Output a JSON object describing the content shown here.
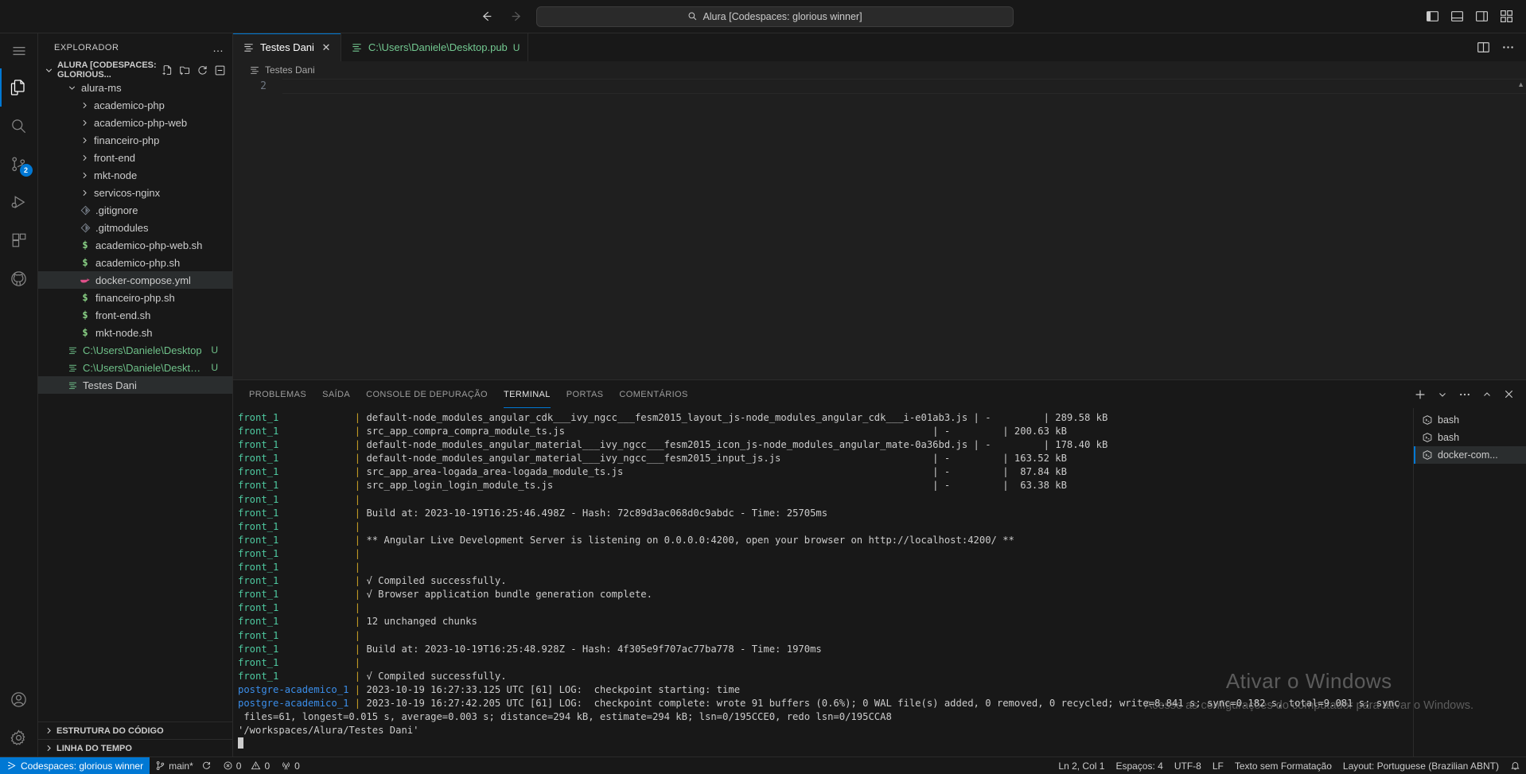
{
  "titlebar": {
    "back_icon": "arrow-left-icon",
    "forward_icon": "arrow-right-icon",
    "search_text": "Alura [Codespaces: glorious winner]",
    "search_placeholder": "Pesquisar",
    "layout_icons": [
      "toggle-primary-sidebar-icon",
      "toggle-panel-icon",
      "toggle-secondary-sidebar-icon",
      "customize-layout-icon"
    ]
  },
  "activitybar": {
    "items": [
      {
        "name": "menu-icon",
        "label": "Menu",
        "badge": ""
      },
      {
        "name": "explorer-icon",
        "label": "Explorador",
        "badge": ""
      },
      {
        "name": "search-icon",
        "label": "Pesquisar",
        "badge": ""
      },
      {
        "name": "source-control-icon",
        "label": "Controle do Código-Fonte",
        "badge": "2"
      },
      {
        "name": "run-debug-icon",
        "label": "Executar e Depurar",
        "badge": ""
      },
      {
        "name": "extensions-icon",
        "label": "Extensões",
        "badge": ""
      },
      {
        "name": "github-icon",
        "label": "GitHub",
        "badge": ""
      }
    ],
    "bottom": [
      {
        "name": "accounts-icon",
        "label": "Contas"
      },
      {
        "name": "settings-gear-icon",
        "label": "Gerenciar"
      }
    ]
  },
  "sidebar": {
    "title": "EXPLORADOR",
    "more_actions": "…",
    "project": {
      "label": "ALURA [CODESPACES: GLORIOUS...",
      "actions": [
        "new-file-icon",
        "new-folder-icon",
        "refresh-icon",
        "collapse-all-icon"
      ]
    },
    "tree": [
      {
        "label": "alura-ms",
        "type": "folder",
        "depth": 1,
        "expanded": true,
        "icon": "chevron-down-icon",
        "badge": ""
      },
      {
        "label": "academico-php",
        "type": "folder",
        "depth": 2,
        "expanded": false,
        "icon": "chevron-right-icon",
        "badge": ""
      },
      {
        "label": "academico-php-web",
        "type": "folder",
        "depth": 2,
        "expanded": false,
        "icon": "chevron-right-icon",
        "badge": ""
      },
      {
        "label": "financeiro-php",
        "type": "folder",
        "depth": 2,
        "expanded": false,
        "icon": "chevron-right-icon",
        "badge": ""
      },
      {
        "label": "front-end",
        "type": "folder",
        "depth": 2,
        "expanded": false,
        "icon": "chevron-right-icon",
        "badge": ""
      },
      {
        "label": "mkt-node",
        "type": "folder",
        "depth": 2,
        "expanded": false,
        "icon": "chevron-right-icon",
        "badge": ""
      },
      {
        "label": "servicos-nginx",
        "type": "folder",
        "depth": 2,
        "expanded": false,
        "icon": "chevron-right-icon",
        "badge": ""
      },
      {
        "label": ".gitignore",
        "type": "git",
        "depth": 2,
        "icon": "git-file-icon",
        "badge": ""
      },
      {
        "label": ".gitmodules",
        "type": "git",
        "depth": 2,
        "icon": "git-file-icon",
        "badge": ""
      },
      {
        "label": "academico-php-web.sh",
        "type": "shell",
        "depth": 2,
        "icon": "shell-file-icon",
        "badge": ""
      },
      {
        "label": "academico-php.sh",
        "type": "shell",
        "depth": 2,
        "icon": "shell-file-icon",
        "badge": ""
      },
      {
        "label": "docker-compose.yml",
        "type": "docker",
        "depth": 2,
        "icon": "docker-file-icon",
        "badge": "",
        "selected": true
      },
      {
        "label": "financeiro-php.sh",
        "type": "shell",
        "depth": 2,
        "icon": "shell-file-icon",
        "badge": ""
      },
      {
        "label": "front-end.sh",
        "type": "shell",
        "depth": 2,
        "icon": "shell-file-icon",
        "badge": ""
      },
      {
        "label": "mkt-node.sh",
        "type": "shell",
        "depth": 2,
        "icon": "shell-file-icon",
        "badge": ""
      },
      {
        "label": "C:\\Users\\Daniele\\Desktop",
        "type": "text",
        "depth": 1,
        "icon": "text-file-icon",
        "badge": "U",
        "green": true
      },
      {
        "label": "C:\\Users\\Daniele\\Desktop.pub",
        "type": "text",
        "depth": 1,
        "icon": "text-file-icon",
        "badge": "U",
        "green": true
      },
      {
        "label": "Testes Dani",
        "type": "text",
        "depth": 1,
        "icon": "text-file-icon",
        "badge": "",
        "selected": true
      }
    ],
    "sections": [
      {
        "label": "ESTRUTURA DO CÓDIGO",
        "icon": "chevron-right-icon"
      },
      {
        "label": "LINHA DO TEMPO",
        "icon": "chevron-right-icon"
      }
    ]
  },
  "editor": {
    "tabs": [
      {
        "label": "Testes Dani",
        "active": true,
        "icon": "text-file-icon",
        "close": "✕",
        "dirty": "",
        "green": false
      },
      {
        "label": "C:\\Users\\Daniele\\Desktop.pub",
        "active": false,
        "icon": "text-file-icon",
        "close": "",
        "dirty": "U",
        "green": true
      }
    ],
    "actions": [
      "split-editor-icon",
      "more-actions-icon"
    ],
    "breadcrumb": "Testes Dani",
    "breadcrumb_icon": "text-file-icon",
    "line_number": "2"
  },
  "panel": {
    "tabs": [
      {
        "label": "PROBLEMAS",
        "active": false
      },
      {
        "label": "SAÍDA",
        "active": false
      },
      {
        "label": "CONSOLE DE DEPURAÇÃO",
        "active": false
      },
      {
        "label": "TERMINAL",
        "active": true
      },
      {
        "label": "PORTAS",
        "active": false
      },
      {
        "label": "COMENTÁRIOS",
        "active": false
      }
    ],
    "actions": [
      "add-terminal-icon",
      "chevron-down-icon",
      "more-actions-icon",
      "chevron-up-icon",
      "close-icon"
    ],
    "terminal_list": [
      {
        "label": "bash",
        "icon": "terminal-bash-icon",
        "active": false
      },
      {
        "label": "bash",
        "icon": "terminal-bash-icon",
        "active": false
      },
      {
        "label": "docker-com...",
        "icon": "terminal-bash-icon",
        "active": true
      }
    ],
    "terminal_lines": [
      {
        "svc": "front_1",
        "svc_color": "green",
        "bar": "|",
        "text": "default-node_modules_angular_cdk___ivy_ngcc___fesm2015_layout_js-node_modules_angular_cdk___i-e01ab3.js | -         | 289.58 kB"
      },
      {
        "svc": "front_1",
        "svc_color": "green",
        "bar": "|",
        "text": "src_app_compra_compra_module_ts.js                                                               | -         | 200.63 kB"
      },
      {
        "svc": "front_1",
        "svc_color": "green",
        "bar": "|",
        "text": "default-node_modules_angular_material___ivy_ngcc___fesm2015_icon_js-node_modules_angular_mate-0a36bd.js | -         | 178.40 kB"
      },
      {
        "svc": "front_1",
        "svc_color": "green",
        "bar": "|",
        "text": "default-node_modules_angular_material___ivy_ngcc___fesm2015_input_js.js                          | -         | 163.52 kB"
      },
      {
        "svc": "front_1",
        "svc_color": "green",
        "bar": "|",
        "text": "src_app_area-logada_area-logada_module_ts.js                                                     | -         |  87.84 kB"
      },
      {
        "svc": "front_1",
        "svc_color": "green",
        "bar": "|",
        "text": "src_app_login_login_module_ts.js                                                                 | -         |  63.38 kB"
      },
      {
        "svc": "front_1",
        "svc_color": "green",
        "bar": "|",
        "text": ""
      },
      {
        "svc": "front_1",
        "svc_color": "green",
        "bar": "|",
        "text": "Build at: 2023-10-19T16:25:46.498Z - Hash: 72c89d3ac068d0c9abdc - Time: 25705ms"
      },
      {
        "svc": "front_1",
        "svc_color": "green",
        "bar": "|",
        "text": ""
      },
      {
        "svc": "front_1",
        "svc_color": "green",
        "bar": "|",
        "text": "** Angular Live Development Server is listening on 0.0.0.0:4200, open your browser on http://localhost:4200/ **"
      },
      {
        "svc": "front_1",
        "svc_color": "green",
        "bar": "|",
        "text": ""
      },
      {
        "svc": "front_1",
        "svc_color": "green",
        "bar": "|",
        "text": ""
      },
      {
        "svc": "front_1",
        "svc_color": "green",
        "bar": "|",
        "text": "√ Compiled successfully."
      },
      {
        "svc": "front_1",
        "svc_color": "green",
        "bar": "|",
        "text": "√ Browser application bundle generation complete."
      },
      {
        "svc": "front_1",
        "svc_color": "green",
        "bar": "|",
        "text": ""
      },
      {
        "svc": "front_1",
        "svc_color": "green",
        "bar": "|",
        "text": "12 unchanged chunks"
      },
      {
        "svc": "front_1",
        "svc_color": "green",
        "bar": "|",
        "text": ""
      },
      {
        "svc": "front_1",
        "svc_color": "green",
        "bar": "|",
        "text": "Build at: 2023-10-19T16:25:48.928Z - Hash: 4f305e9f707ac77ba778 - Time: 1970ms"
      },
      {
        "svc": "front_1",
        "svc_color": "green",
        "bar": "|",
        "text": ""
      },
      {
        "svc": "front_1",
        "svc_color": "green",
        "bar": "|",
        "text": "√ Compiled successfully."
      },
      {
        "svc": "postgre-academico_1",
        "svc_color": "blue",
        "bar": "|",
        "text": "2023-10-19 16:27:33.125 UTC [61] LOG:  checkpoint starting: time"
      },
      {
        "svc": "postgre-academico_1",
        "svc_color": "blue",
        "bar": "|",
        "text": "2023-10-19 16:27:42.205 UTC [61] LOG:  checkpoint complete: wrote 91 buffers (0.6%); 0 WAL file(s) added, 0 removed, 0 recycled; write=8.841 s; sync=0.182 s, total=9.081 s; sync"
      },
      {
        "svc": "",
        "svc_color": "",
        "bar": "",
        "text": " files=61, longest=0.015 s, average=0.003 s; distance=294 kB, estimate=294 kB; lsn=0/195CCE0, redo lsn=0/195CCA8"
      },
      {
        "svc": "",
        "svc_color": "",
        "bar": "",
        "text": "'/workspaces/Alura/Testes Dani'"
      }
    ]
  },
  "statusbar": {
    "remote_label": "Codespaces: glorious winner",
    "remote_icon": "remote-explorer-icon",
    "branch": "main*",
    "branch_icon": "source-control-branch-icon",
    "sync_icon": "sync-icon",
    "errors": "0",
    "errors_icon": "error-icon",
    "warnings": "0",
    "warnings_icon": "warning-icon",
    "ports": "0",
    "ports_icon": "radio-tower-icon",
    "cursor_position": "Ln 2, Col 1",
    "indentation": "Espaços: 4",
    "encoding": "UTF-8",
    "eol": "LF",
    "language": "Texto sem Formatação",
    "keyboard_layout": "Layout: Portuguese (Brazilian ABNT)",
    "bell_icon": "bell-icon"
  },
  "watermark": {
    "title": "Ativar o Windows",
    "subtitle": "Acesse as configurações do computador para ativar o Windows."
  },
  "colors": {
    "accent": "#0078d4",
    "bg": "#1f1f1f",
    "chrome": "#181818",
    "green": "#4ec9a0",
    "blue": "#3b8eea"
  }
}
